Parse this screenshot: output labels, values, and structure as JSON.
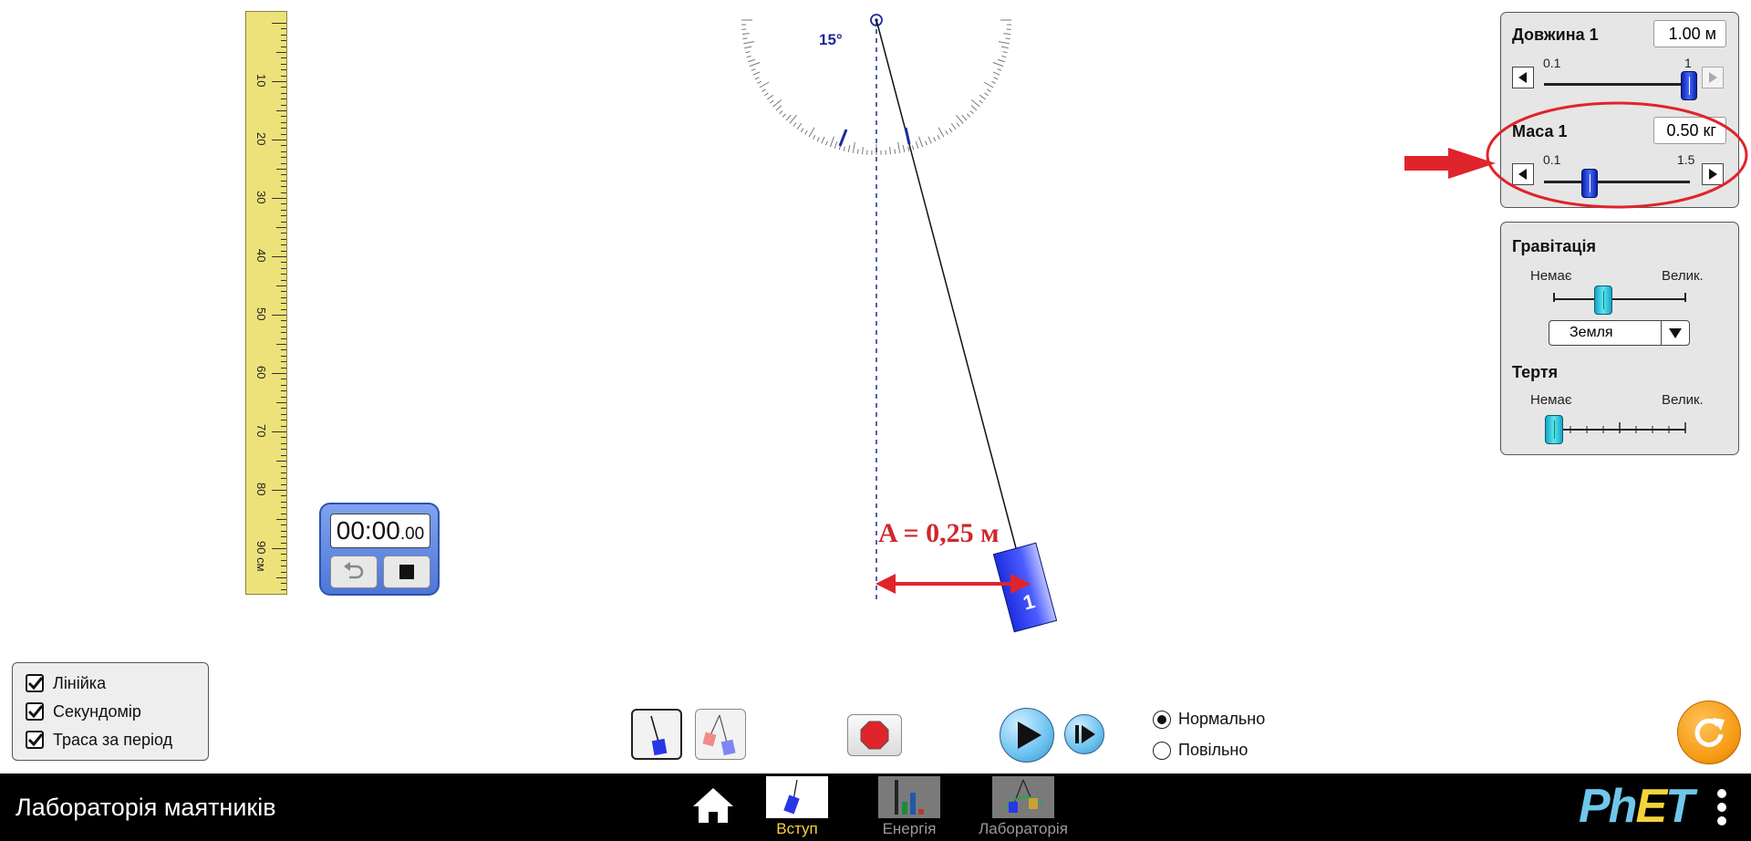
{
  "ruler": {
    "labels": [
      "10",
      "20",
      "30",
      "40",
      "50",
      "60",
      "70",
      "80",
      "90 см"
    ]
  },
  "protractor": {
    "angle_label": "15°"
  },
  "annotation": {
    "amplitude_text": "A = 0,25 м"
  },
  "pendulum": {
    "mass_label": "1"
  },
  "stopwatch": {
    "time_main": "00:00",
    "time_fraction": ".00"
  },
  "length_panel": {
    "title": "Довжина 1",
    "value": "1.00 м",
    "min": "0.1",
    "max": "1",
    "slider_fraction": 1.0
  },
  "mass_panel": {
    "title": "Маса 1",
    "value": "0.50 кг",
    "min": "0.1",
    "max": "1.5",
    "slider_fraction": 0.286
  },
  "gravity_panel": {
    "title": "Гравітація",
    "min_label": "Немає",
    "max_label": "Велик.",
    "slider_fraction": 0.39,
    "select_value": "Земля"
  },
  "friction_panel": {
    "title": "Тертя",
    "min_label": "Немає",
    "max_label": "Велик.",
    "slider_fraction": 0.0
  },
  "checkboxes": [
    {
      "label": "Лінійка",
      "checked": true
    },
    {
      "label": "Секундомір",
      "checked": true
    },
    {
      "label": "Траса за період",
      "checked": true
    }
  ],
  "speed": {
    "normal": "Нормально",
    "slow": "Повільно",
    "selected": "normal"
  },
  "navbar": {
    "title": "Лабораторія маятників",
    "tabs": [
      {
        "label": "Вступ",
        "active": true
      },
      {
        "label": "Енергія",
        "active": false
      },
      {
        "label": "Лабораторія",
        "active": false
      }
    ],
    "brand": "PhET"
  },
  "colors": {
    "accent_red": "#e0242b",
    "tab_active": "#f5d33b",
    "tab_inactive": "#9a9a9a",
    "phet_blue": "#6fc7ea",
    "phet_yellow": "#f5d33b"
  }
}
